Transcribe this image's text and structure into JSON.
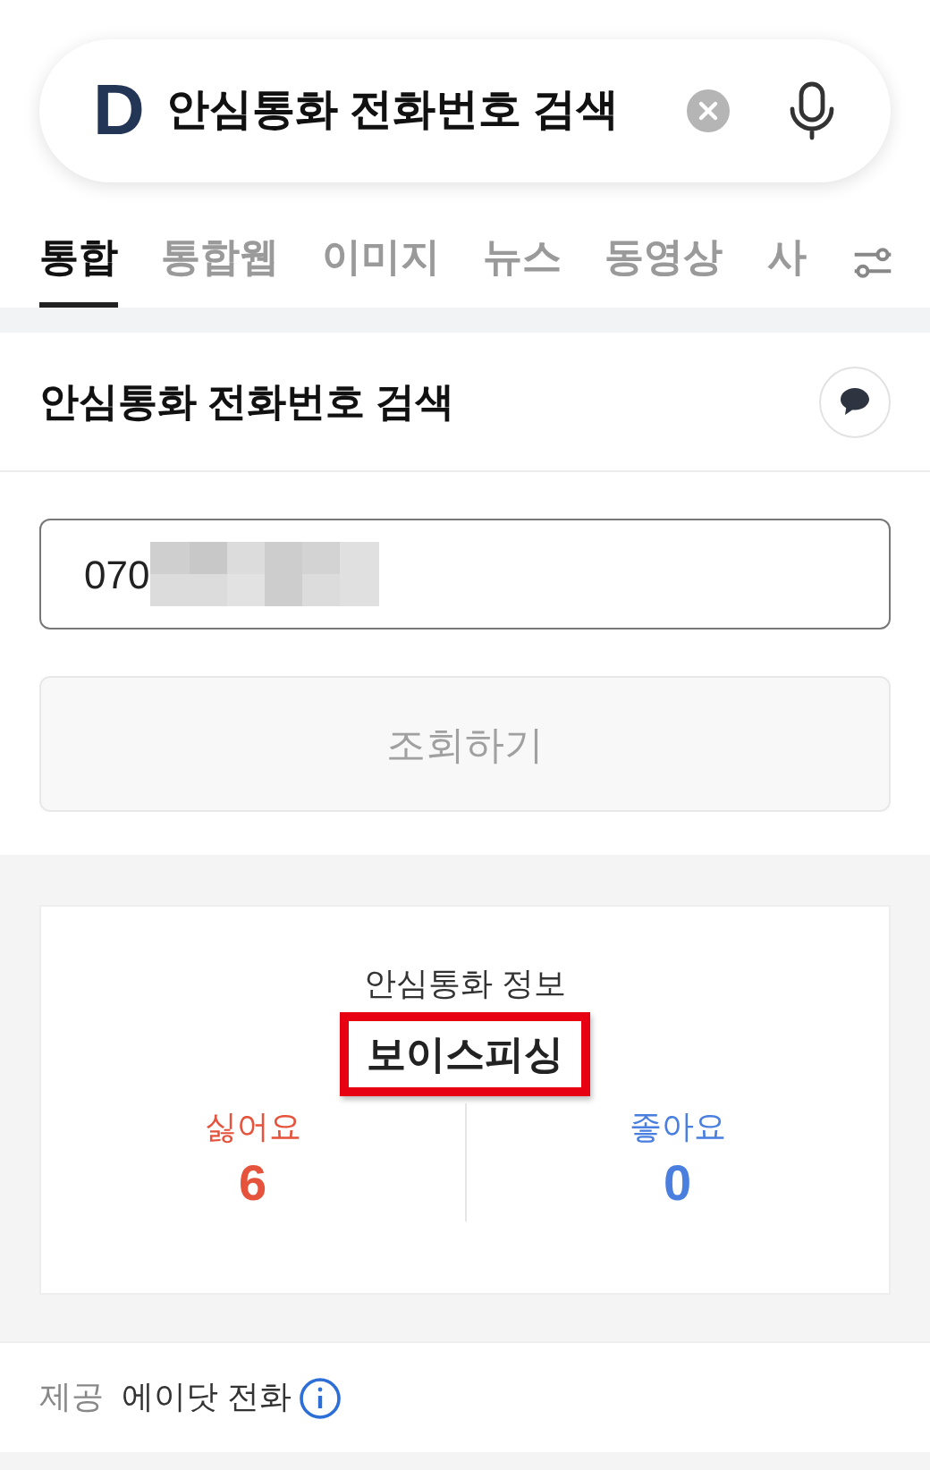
{
  "search_bar": {
    "logo": "D",
    "query": "안심통화 전화번호 검색"
  },
  "tabs": [
    {
      "label": "통합",
      "selected": true
    },
    {
      "label": "통합웹",
      "selected": false
    },
    {
      "label": "이미지",
      "selected": false
    },
    {
      "label": "뉴스",
      "selected": false
    },
    {
      "label": "동영상",
      "selected": false
    },
    {
      "label": "사",
      "selected": false
    }
  ],
  "section": {
    "title": "안심통화 전화번호 검색"
  },
  "phone_field": {
    "value": "070"
  },
  "lookup_button": {
    "label": "조회하기",
    "disabled": true
  },
  "info_card": {
    "title": "안심통화 정보",
    "verdict": "보이스피싱",
    "votes": [
      {
        "label": "싫어요",
        "count": "6",
        "color": "#e5533d"
      },
      {
        "label": "좋아요",
        "count": "0",
        "color": "#4a7fe0"
      }
    ]
  },
  "footer": {
    "label": "제공",
    "provider": "에이닷 전화"
  }
}
